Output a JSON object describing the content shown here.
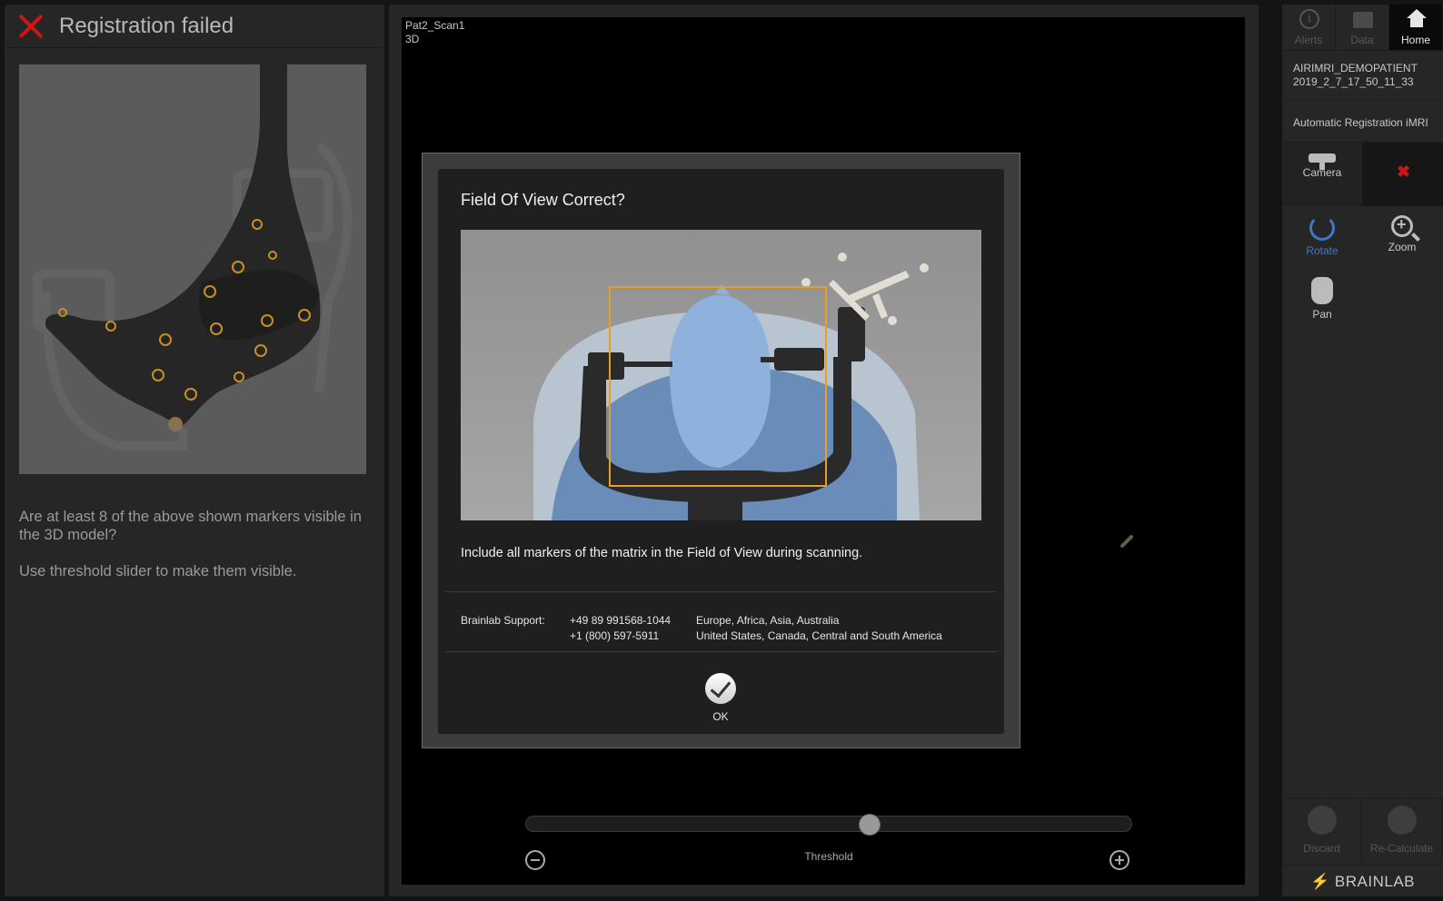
{
  "left_panel": {
    "title": "Registration failed",
    "text_1": "Are at least 8 of the above shown markers visible in the 3D model?",
    "text_2": "Use threshold slider to make them visible."
  },
  "viewport": {
    "scan_name": "Pat2_Scan1",
    "view_mode": "3D"
  },
  "threshold": {
    "label": "Threshold",
    "value_fraction": 0.57
  },
  "dialog": {
    "title": "Field Of View Correct?",
    "message": "Include all markers of the matrix in the Field of View during scanning.",
    "support_label": "Brainlab Support:",
    "phone_1": "+49 89 991568-1044",
    "phone_2": "+1 (800) 597-5911",
    "region_1": "Europe, Africa, Asia, Australia",
    "region_2": "United States, Canada, Central and South America",
    "ok_label": "OK"
  },
  "right_panel": {
    "tabs": [
      {
        "label": "Alerts",
        "icon": "info-icon"
      },
      {
        "label": "Data",
        "icon": "data-icon"
      },
      {
        "label": "Home",
        "icon": "home-icon"
      }
    ],
    "patient_name": "AIRIMRI_DEMOPATIENT",
    "patient_date": "2019_2_7_17_50_11_33",
    "workflow": "Automatic Registration iMRI",
    "tools": {
      "camera": "Camera",
      "rotate": "Rotate",
      "zoom": "Zoom",
      "pan": "Pan"
    },
    "discard": "Discard",
    "recalculate": "Re-Calculate",
    "brand": "BRAINLAB"
  },
  "colors": {
    "error_red": "#d21414",
    "accent_blue": "#3a7ac8",
    "fov_orange": "#e8a020"
  }
}
